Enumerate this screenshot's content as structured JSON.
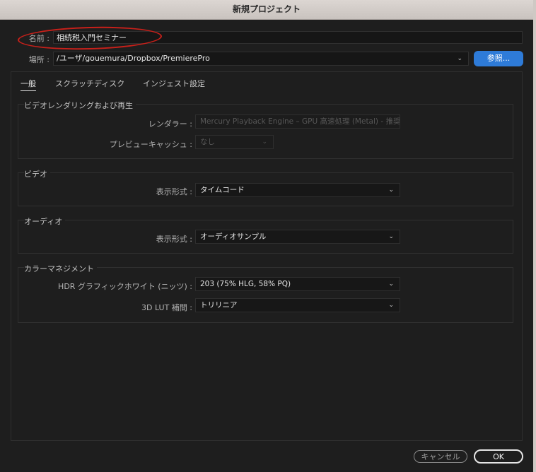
{
  "window": {
    "title": "新規プロジェクト"
  },
  "name_row": {
    "label": "名前 :",
    "value": "相続税入門セミナー"
  },
  "location_row": {
    "label": "場所 :",
    "value": "/ユーザ/gouemura/Dropbox/PremierePro",
    "browse_label": "参照..."
  },
  "tabs": [
    {
      "label": "一般",
      "active": true
    },
    {
      "label": "スクラッチディスク",
      "active": false
    },
    {
      "label": "インジェスト設定",
      "active": false
    }
  ],
  "video_rendering": {
    "title": "ビデオレンダリングおよび再生",
    "renderer_label": "レンダラー :",
    "renderer_value": "Mercury Playback Engine – GPU 高速処理 (Metal) - 推奨",
    "preview_cache_label": "プレビューキャッシュ :",
    "preview_cache_value": "なし"
  },
  "video": {
    "title": "ビデオ",
    "display_format_label": "表示形式 :",
    "display_format_value": "タイムコード"
  },
  "audio": {
    "title": "オーディオ",
    "display_format_label": "表示形式 :",
    "display_format_value": "オーディオサンプル"
  },
  "color_management": {
    "title": "カラーマネジメント",
    "hdr_label": "HDR グラフィックホワイト (ニッツ) :",
    "hdr_value": "203 (75% HLG, 58% PQ)",
    "lut_label": "3D LUT 補間 :",
    "lut_value": "トリリニア"
  },
  "footer": {
    "cancel_label": "キャンセル",
    "ok_label": "OK"
  },
  "colors": {
    "accent": "#2e7bd8",
    "annotation": "#c8201a",
    "background": "#1e1e1e"
  }
}
